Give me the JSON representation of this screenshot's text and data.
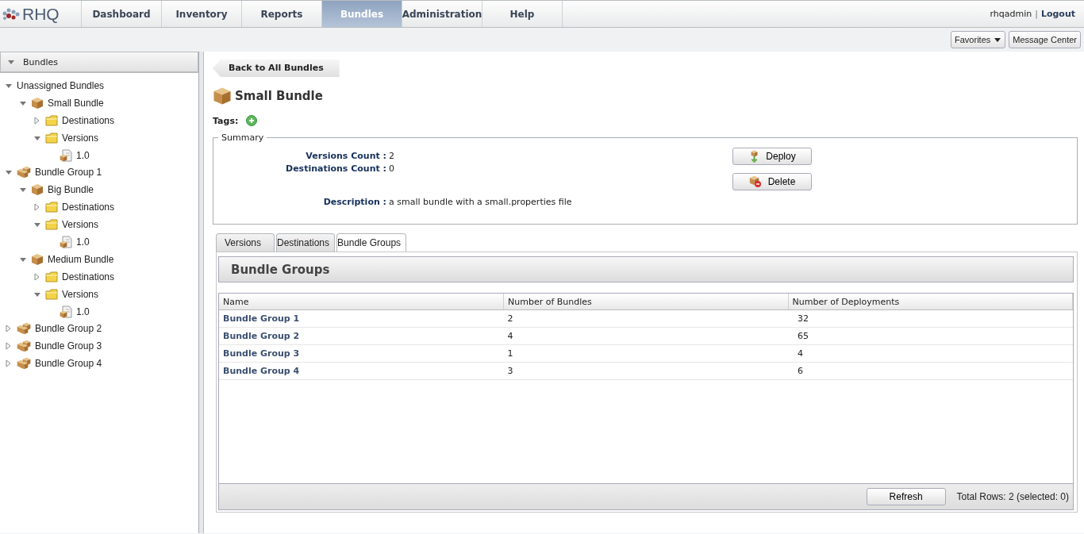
{
  "logo": {
    "text": "RHQ"
  },
  "nav": [
    {
      "label": "Dashboard",
      "selected": false
    },
    {
      "label": "Inventory",
      "selected": false
    },
    {
      "label": "Reports",
      "selected": false
    },
    {
      "label": "Bundles",
      "selected": true
    },
    {
      "label": "Administration",
      "selected": false
    },
    {
      "label": "Help",
      "selected": false
    }
  ],
  "user": {
    "name": "rhqadmin",
    "separator": "|",
    "logout": "Logout"
  },
  "toolbar": {
    "favorites": "Favorites",
    "message_center": "Message Center"
  },
  "sidebar": {
    "title": "Bundles",
    "expanded": true,
    "tree": [
      {
        "label": "Unassigned Bundles",
        "kind": "category",
        "expanded": true,
        "children": [
          {
            "label": "Small Bundle",
            "kind": "bundle",
            "expanded": true,
            "children": [
              {
                "label": "Destinations",
                "kind": "folder",
                "expanded": false
              },
              {
                "label": "Versions",
                "kind": "folder",
                "expanded": true,
                "children": [
                  {
                    "label": "1.0",
                    "kind": "version"
                  }
                ]
              }
            ]
          }
        ]
      },
      {
        "label": "Bundle Group 1",
        "kind": "group",
        "expanded": true,
        "children": [
          {
            "label": "Big Bundle",
            "kind": "bundle",
            "expanded": true,
            "children": [
              {
                "label": "Destinations",
                "kind": "folder",
                "expanded": false
              },
              {
                "label": "Versions",
                "kind": "folder",
                "expanded": true,
                "children": [
                  {
                    "label": "1.0",
                    "kind": "version"
                  }
                ]
              }
            ]
          },
          {
            "label": "Medium Bundle",
            "kind": "bundle",
            "expanded": true,
            "children": [
              {
                "label": "Destinations",
                "kind": "folder",
                "expanded": false
              },
              {
                "label": "Versions",
                "kind": "folder",
                "expanded": true,
                "children": [
                  {
                    "label": "1.0",
                    "kind": "version"
                  }
                ]
              }
            ]
          }
        ]
      },
      {
        "label": "Bundle Group 2",
        "kind": "group",
        "expanded": false
      },
      {
        "label": "Bundle Group 3",
        "kind": "group",
        "expanded": false
      },
      {
        "label": "Bundle Group 4",
        "kind": "group",
        "expanded": false
      }
    ]
  },
  "detail": {
    "back": "Back to All Bundles",
    "title": "Small Bundle",
    "tags_label": "Tags:",
    "summary": {
      "legend": "Summary",
      "fields": [
        {
          "label": "Versions Count :",
          "value": "2"
        },
        {
          "label": "Destinations Count :",
          "value": "0"
        }
      ],
      "description": {
        "label": "Description :",
        "value": "a small bundle with a small.properties file"
      },
      "buttons": [
        {
          "label": "Deploy",
          "kind": "deploy"
        },
        {
          "label": "Delete",
          "kind": "delete"
        }
      ]
    },
    "tabs": [
      {
        "label": "Versions",
        "selected": false
      },
      {
        "label": "Destinations",
        "selected": false
      },
      {
        "label": "Bundle Groups",
        "selected": true
      }
    ],
    "section_title": "Bundle Groups",
    "table": {
      "columns": [
        "Name",
        "Number of Bundles",
        "Number of Deployments"
      ],
      "rows": [
        [
          "Bundle Group 1",
          "2",
          "32"
        ],
        [
          "Bundle Group 2",
          "4",
          "65"
        ],
        [
          "Bundle Group 3",
          "1",
          "4"
        ],
        [
          "Bundle Group 4",
          "3",
          "6"
        ]
      ]
    },
    "footer": {
      "refresh": "Refresh",
      "total": "Total Rows: 2 (selected: 0)"
    }
  }
}
